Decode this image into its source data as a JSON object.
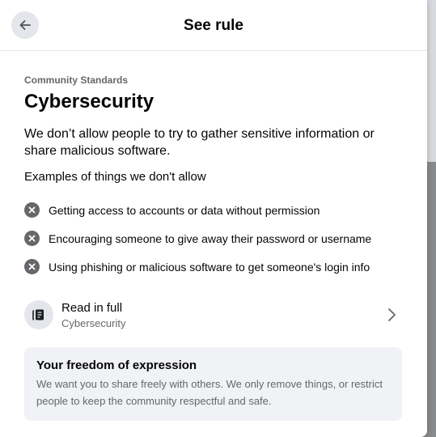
{
  "header": {
    "title": "See rule"
  },
  "content": {
    "eyebrow": "Community Standards",
    "heading": "Cybersecurity",
    "description": "We don’t allow people to try to gather sensitive information or share malicious software.",
    "examples_heading": "Examples of things we don't allow",
    "examples": [
      "Getting access to accounts or data without permission",
      "Encouraging someone to give away their password or username",
      "Using phishing or malicious software to get someone's login info"
    ]
  },
  "read_full": {
    "title": "Read in full",
    "subtitle": "Cybersecurity",
    "icon": "document-icon"
  },
  "freedom": {
    "title": "Your freedom of expression",
    "body": "We want you to share freely with others. We only remove things, or restrict people to keep the community respectful and safe."
  },
  "colors": {
    "muted_text": "#65676b",
    "panel_bg": "#f0f2f5",
    "icon_bg": "#e4e6eb"
  }
}
